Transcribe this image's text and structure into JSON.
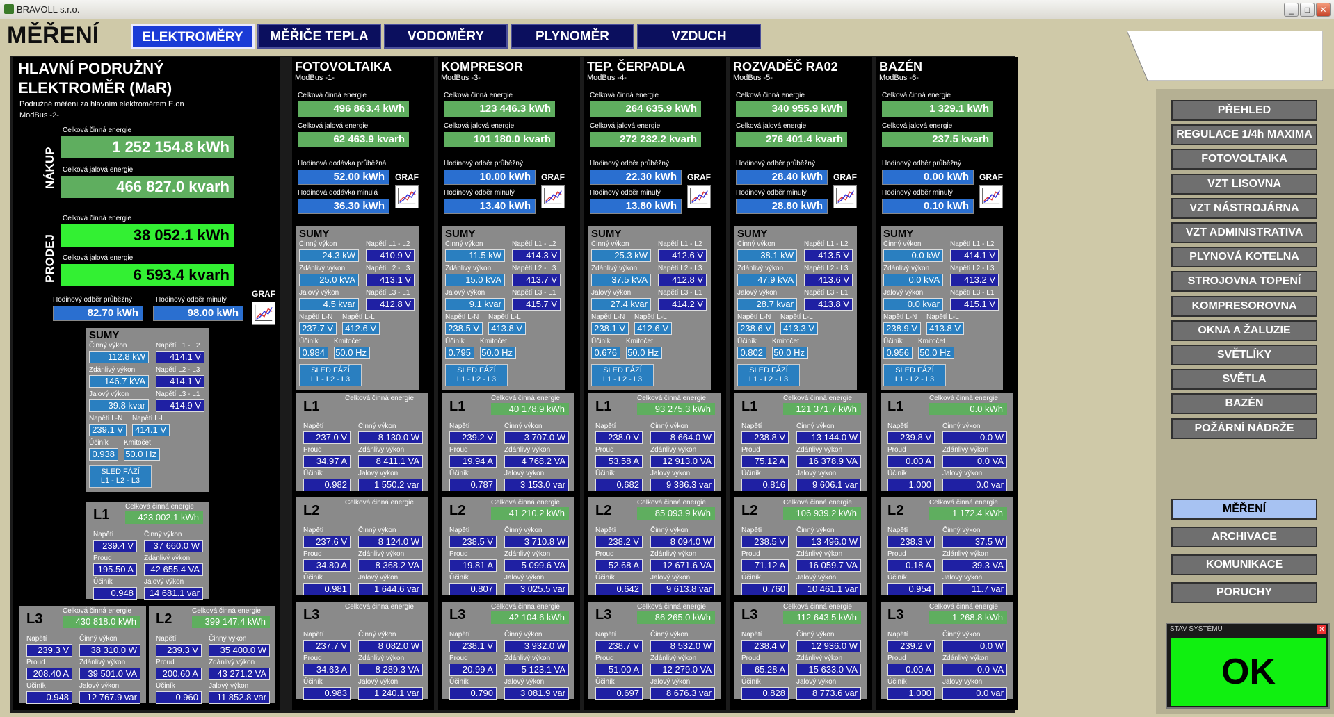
{
  "app": {
    "title": "BRAVOLL s.r.o.",
    "min": "_",
    "max": "□",
    "close": "✕"
  },
  "header": {
    "title": "MĚŘENÍ",
    "tabs": [
      "ELEKTROMĚRY",
      "MĚŘIČE TEPLA",
      "VODOMĚRY",
      "PLYNOMĚR",
      "VZDUCH"
    ]
  },
  "colors": {
    "bg": "#cfc9a8",
    "panel": "#000000",
    "value": "#1f20a3",
    "green": "#5fae5f",
    "bright_green": "#33f033",
    "blue": "#2a6fd0"
  },
  "labels": {
    "celk_cin": "Celková činná energie",
    "celk_jal": "Celková jalová energie",
    "hod_dod_pr": "Hodinová dodávka průběžná",
    "hod_dod_min": "Hodinová dodávka minulá",
    "hod_odb_pr": "Hodinový odběr průběžný",
    "hod_odb_min": "Hodinový odběr minulý",
    "graf": "GRAF",
    "sumy": "SUMY",
    "cinny": "Činný výkon",
    "zdanlivy": "Zdánlivý výkon",
    "jalovy": "Jalový výkon",
    "nap_ln": "Napětí L-N",
    "nap_ll": "Napětí L-L",
    "ucinik": "Účiník",
    "kmitocet": "Kmitočet",
    "nap_l1l2": "Napětí L1 - L2",
    "nap_l2l3": "Napětí L2 - L3",
    "nap_l3l1": "Napětí L3 - L1",
    "sled1": "SLED FÁZÍ",
    "sled2": "L1 - L2 - L3",
    "napeti": "Napětí",
    "proud": "Proud",
    "nakup": "NÁKUP",
    "prodej": "PRODEJ"
  },
  "main": {
    "title1": "HLAVNÍ PODRUŽNÝ",
    "title2": "ELEKTROMĚR (MaR)",
    "sub": "Podružné měření za hlavním elektroměrem E.on",
    "modbus": "ModBus -2-",
    "nakup_cin": "1 252 154.8 kWh",
    "nakup_jal": "466 827.0 kvarh",
    "prodej_cin": "38 052.1 kWh",
    "prodej_jal": "6 593.4 kvarh",
    "hod_pr": "82.70 kWh",
    "hod_min": "98.00 kWh",
    "sumy": {
      "cin": "112.8 kW",
      "zd": "146.7 kVA",
      "jal": "39.8 kvar",
      "l1l2": "414.1 V",
      "l2l3": "414.1 V",
      "l3l1": "414.9 V",
      "ln": "239.1 V",
      "ll": "414.1 V",
      "uc": "0.938",
      "km": "50.0 Hz"
    },
    "L1": {
      "e": "423 002.1 kWh",
      "u": "239.4 V",
      "i": "195.50 A",
      "pf": "0.948",
      "p": "37 660.0 W",
      "s": "42 655.4 VA",
      "q": "14 681.1 var"
    },
    "L3": {
      "e": "430 818.0 kWh",
      "u": "239.3 V",
      "i": "208.40 A",
      "pf": "0.948",
      "p": "38 310.0 W",
      "s": "39 501.0 VA",
      "q": "12 767.9 var"
    },
    "L2": {
      "e": "399 147.4 kWh",
      "u": "239.3 V",
      "i": "200.60 A",
      "pf": "0.960",
      "p": "35 400.0 W",
      "s": "43 271.2 VA",
      "q": "11 852.8 var"
    }
  },
  "meters": [
    {
      "name": "FOTOVOLTAIKA",
      "modbus": "ModBus -1-",
      "cin": "496 863.4 kWh",
      "jal": "62 463.9 kvarh",
      "l_pr": "hod_dod_pr",
      "l_min": "hod_dod_min",
      "pr": "52.00 kWh",
      "min": "36.30 kWh",
      "sumy": {
        "cin": "24.3 kW",
        "zd": "25.0 kVA",
        "jal": "4.5 kvar",
        "l1l2": "410.9 V",
        "l2l3": "413.1 V",
        "l3l1": "412.8 V",
        "ln": "237.7 V",
        "ll": "412.6 V",
        "uc": "0.984",
        "km": "50.0 Hz"
      },
      "L": [
        {
          "n": "L1",
          "e": "",
          "u": "237.0 V",
          "i": "34.97 A",
          "pf": "0.982",
          "p": "8 130.0 W",
          "s": "8 411.1 VA",
          "q": "1 550.2 var"
        },
        {
          "n": "L2",
          "e": "",
          "u": "237.6 V",
          "i": "34.80 A",
          "pf": "0.981",
          "p": "8 124.0 W",
          "s": "8 368.2 VA",
          "q": "1 644.6 var"
        },
        {
          "n": "L3",
          "e": "",
          "u": "237.7 V",
          "i": "34.63 A",
          "pf": "0.983",
          "p": "8 082.0 W",
          "s": "8 289.3 VA",
          "q": "1 240.1 var"
        }
      ]
    },
    {
      "name": "KOMPRESOR",
      "modbus": "ModBus -3-",
      "cin": "123 446.3 kWh",
      "jal": "101 180.0 kvarh",
      "l_pr": "hod_odb_pr",
      "l_min": "hod_odb_min",
      "pr": "10.00 kWh",
      "min": "13.40 kWh",
      "sumy": {
        "cin": "11.5 kW",
        "zd": "15.0 kVA",
        "jal": "9.1 kvar",
        "l1l2": "414.3 V",
        "l2l3": "413.7 V",
        "l3l1": "415.7 V",
        "ln": "238.5 V",
        "ll": "413.8 V",
        "uc": "0.795",
        "km": "50.0 Hz"
      },
      "L": [
        {
          "n": "L1",
          "e": "40 178.9 kWh",
          "u": "239.2 V",
          "i": "19.94 A",
          "pf": "0.787",
          "p": "3 707.0 W",
          "s": "4 768.2 VA",
          "q": "3 153.0 var"
        },
        {
          "n": "L2",
          "e": "41 210.2 kWh",
          "u": "238.5 V",
          "i": "19.81 A",
          "pf": "0.807",
          "p": "3 710.8 W",
          "s": "5 099.6 VA",
          "q": "3 025.5 var"
        },
        {
          "n": "L3",
          "e": "42 104.6 kWh",
          "u": "238.1 V",
          "i": "20.99 A",
          "pf": "0.790",
          "p": "3 932.0 W",
          "s": "5 123.1 VA",
          "q": "3 081.9 var"
        }
      ]
    },
    {
      "name": "TEP. ČERPADLA",
      "modbus": "ModBus -4-",
      "cin": "264 635.9 kWh",
      "jal": "272 232.2 kvarh",
      "l_pr": "hod_odb_pr",
      "l_min": "hod_odb_min",
      "pr": "22.30 kWh",
      "min": "13.80 kWh",
      "sumy": {
        "cin": "25.3 kW",
        "zd": "37.5 kVA",
        "jal": "27.4 kvar",
        "l1l2": "412.6 V",
        "l2l3": "412.8 V",
        "l3l1": "414.2 V",
        "ln": "238.1 V",
        "ll": "412.6 V",
        "uc": "0.676",
        "km": "50.0 Hz"
      },
      "L": [
        {
          "n": "L1",
          "e": "93 275.3 kWh",
          "u": "238.0 V",
          "i": "53.58 A",
          "pf": "0.682",
          "p": "8 664.0 W",
          "s": "12 913.0 VA",
          "q": "9 386.3 var"
        },
        {
          "n": "L2",
          "e": "85 093.9 kWh",
          "u": "238.2 V",
          "i": "52.68 A",
          "pf": "0.642",
          "p": "8 094.0 W",
          "s": "12 671.6 VA",
          "q": "9 613.8 var"
        },
        {
          "n": "L3",
          "e": "86 265.0 kWh",
          "u": "238.7 V",
          "i": "51.00 A",
          "pf": "0.697",
          "p": "8 532.0 W",
          "s": "12 279.0 VA",
          "q": "8 676.3 var"
        }
      ]
    },
    {
      "name": "ROZVADĚČ RA02",
      "modbus": "ModBus -5-",
      "cin": "340 955.9 kWh",
      "jal": "276 401.4 kvarh",
      "l_pr": "hod_odb_pr",
      "l_min": "hod_odb_min",
      "pr": "28.40 kWh",
      "min": "28.80 kWh",
      "sumy": {
        "cin": "38.1 kW",
        "zd": "47.9 kVA",
        "jal": "28.7 kvar",
        "l1l2": "413.5 V",
        "l2l3": "413.6 V",
        "l3l1": "413.8 V",
        "ln": "238.6 V",
        "ll": "413.3 V",
        "uc": "0.802",
        "km": "50.0 Hz"
      },
      "L": [
        {
          "n": "L1",
          "e": "121 371.7 kWh",
          "u": "238.8 V",
          "i": "75.12 A",
          "pf": "0.816",
          "p": "13 144.0 W",
          "s": "16 378.9 VA",
          "q": "9 606.1 var"
        },
        {
          "n": "L2",
          "e": "106 939.2 kWh",
          "u": "238.5 V",
          "i": "71.12 A",
          "pf": "0.760",
          "p": "13 496.0 W",
          "s": "16 059.7 VA",
          "q": "10 461.1 var"
        },
        {
          "n": "L3",
          "e": "112 643.5 kWh",
          "u": "238.4 V",
          "i": "65.28 A",
          "pf": "0.828",
          "p": "12 936.0 W",
          "s": "15 633.0 VA",
          "q": "8 773.6 var"
        }
      ]
    },
    {
      "name": "BAZÉN",
      "modbus": "ModBus -6-",
      "cin": "1 329.1 kWh",
      "jal": "237.5 kvarh",
      "l_pr": "hod_odb_pr",
      "l_min": "hod_odb_min",
      "pr": "0.00 kWh",
      "min": "0.10 kWh",
      "sumy": {
        "cin": "0.0 kW",
        "zd": "0.0 kVA",
        "jal": "0.0 kvar",
        "l1l2": "414.1 V",
        "l2l3": "413.2 V",
        "l3l1": "415.1 V",
        "ln": "238.9 V",
        "ll": "413.8 V",
        "uc": "0.956",
        "km": "50.0 Hz"
      },
      "L": [
        {
          "n": "L1",
          "e": "0.0 kWh",
          "u": "239.8 V",
          "i": "0.00 A",
          "pf": "1.000",
          "p": "0.0 W",
          "s": "0.0 VA",
          "q": "0.0 var"
        },
        {
          "n": "L2",
          "e": "1 172.4 kWh",
          "u": "238.3 V",
          "i": "0.18 A",
          "pf": "0.954",
          "p": "37.5 W",
          "s": "39.3 VA",
          "q": "11.7 var"
        },
        {
          "n": "L3",
          "e": "1 268.8 kWh",
          "u": "239.2 V",
          "i": "0.00 A",
          "pf": "1.000",
          "p": "0.0 W",
          "s": "0.0 VA",
          "q": "0.0 var"
        }
      ]
    }
  ],
  "sidebar": {
    "top": [
      "PŘEHLED",
      "REGULACE 1/4h MAXIMA",
      "FOTOVOLTAIKA",
      "VZT LISOVNA",
      "VZT NÁSTROJÁRNA",
      "VZT ADMINISTRATIVA",
      "PLYNOVÁ KOTELNA",
      "STROJOVNA TOPENÍ",
      "KOMPRESOROVNA",
      "OKNA A ŽALUZIE",
      "SVĚTLÍKY",
      "SVĚTLA",
      "BAZÉN",
      "POŽÁRNÍ NÁDRŽE"
    ],
    "bottom": [
      "MĚŘENÍ",
      "ARCHIVACE",
      "KOMUNIKACE",
      "PORUCHY"
    ]
  },
  "status": {
    "title": "STAV SYSTÉMU",
    "value": "OK",
    "close": "✕"
  }
}
